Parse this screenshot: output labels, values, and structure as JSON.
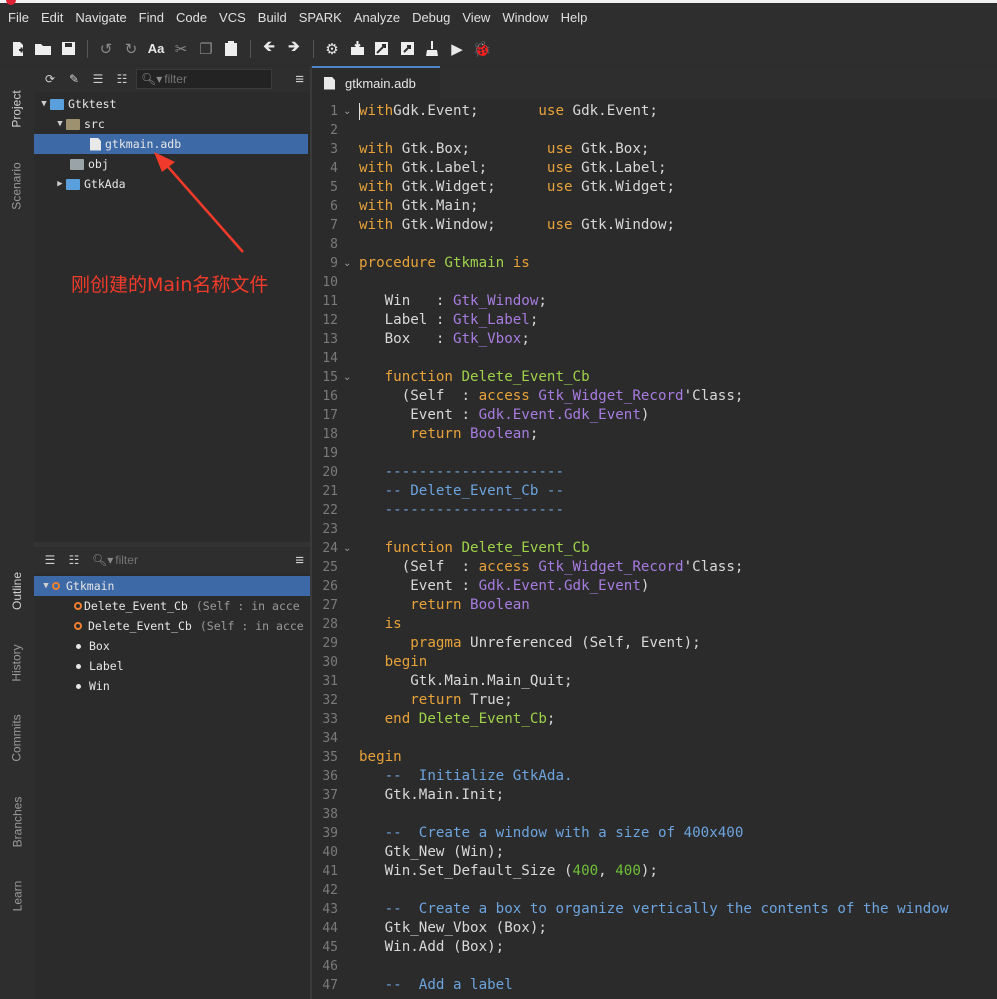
{
  "menubar": {
    "items": [
      "File",
      "Edit",
      "Navigate",
      "Find",
      "Code",
      "VCS",
      "Build",
      "SPARK",
      "Analyze",
      "Debug",
      "View",
      "Window",
      "Help"
    ]
  },
  "toolbar": {
    "buttons": [
      "new-file-icon",
      "open-folder-icon",
      "save-icon",
      "undo-icon",
      "redo-icon",
      "font-case-icon",
      "cut-icon",
      "copy-icon",
      "paste-icon",
      "back-icon",
      "forward-icon",
      "gear-check-icon",
      "build-icon",
      "build-all-icon",
      "build-target-icon",
      "clean-icon",
      "run-icon",
      "debug-icon"
    ]
  },
  "side_tabs": {
    "project": "Project",
    "scenario": "Scenario",
    "outline": "Outline",
    "history": "History",
    "commits": "Commits",
    "branches": "Branches",
    "learn": "Learn"
  },
  "project": {
    "filter_placeholder": "filter",
    "tree": {
      "root": "Gtktest",
      "src": "src",
      "file": "gtkmain.adb",
      "obj": "obj",
      "gtkada": "GtkAda"
    }
  },
  "annotation": {
    "text": "刚创建的Main名称文件"
  },
  "outline": {
    "filter_placeholder": "filter",
    "items": {
      "root": "Gtkmain",
      "cb1": "Delete_Event_Cb",
      "cb1_sig": "(Self : in acce",
      "cb2": "Delete_Event_Cb",
      "cb2_sig": "(Self : in acce",
      "box": "Box",
      "label": "Label",
      "win": "Win"
    }
  },
  "editor": {
    "tab_title": "gtkmain.adb",
    "line_numbers": [
      "1",
      "2",
      "3",
      "4",
      "5",
      "6",
      "7",
      "8",
      "9",
      "10",
      "11",
      "12",
      "13",
      "14",
      "15",
      "16",
      "17",
      "18",
      "19",
      "20",
      "21",
      "22",
      "23",
      "24",
      "25",
      "26",
      "27",
      "28",
      "29",
      "30",
      "31",
      "32",
      "33",
      "34",
      "35",
      "36",
      "37",
      "38",
      "39",
      "40",
      "41",
      "42",
      "43",
      "44",
      "45",
      "46",
      "47"
    ],
    "fold_lines": [
      1,
      9,
      15,
      24
    ],
    "lines": [
      [
        [
          "kw",
          "with"
        ],
        [
          "",
          "Gdk.Event;       "
        ],
        [
          "kw",
          "use"
        ],
        [
          "",
          " Gdk.Event;"
        ]
      ],
      [],
      [
        [
          "kw",
          "with"
        ],
        [
          "",
          " Gtk.Box;         "
        ],
        [
          "kw",
          "use"
        ],
        [
          "",
          " Gtk.Box;"
        ]
      ],
      [
        [
          "kw",
          "with"
        ],
        [
          "",
          " Gtk.Label;       "
        ],
        [
          "kw",
          "use"
        ],
        [
          "",
          " Gtk.Label;"
        ]
      ],
      [
        [
          "kw",
          "with"
        ],
        [
          "",
          " Gtk.Widget;      "
        ],
        [
          "kw",
          "use"
        ],
        [
          "",
          " Gtk.Widget;"
        ]
      ],
      [
        [
          "kw",
          "with"
        ],
        [
          "",
          " Gtk.Main;"
        ]
      ],
      [
        [
          "kw",
          "with"
        ],
        [
          "",
          " Gtk.Window;      "
        ],
        [
          "kw",
          "use"
        ],
        [
          "",
          " Gtk.Window;"
        ]
      ],
      [],
      [
        [
          "kw",
          "procedure"
        ],
        [
          "",
          " "
        ],
        [
          "fn",
          "Gtkmain"
        ],
        [
          "",
          " "
        ],
        [
          "kw",
          "is"
        ]
      ],
      [],
      [
        [
          "",
          "   Win   : "
        ],
        [
          "ty",
          "Gtk_Window"
        ],
        [
          "",
          ";"
        ]
      ],
      [
        [
          "",
          "   Label : "
        ],
        [
          "ty",
          "Gtk_Label"
        ],
        [
          "",
          ";"
        ]
      ],
      [
        [
          "",
          "   Box   : "
        ],
        [
          "ty",
          "Gtk_Vbox"
        ],
        [
          "",
          ";"
        ]
      ],
      [],
      [
        [
          "",
          "   "
        ],
        [
          "kw",
          "function"
        ],
        [
          "",
          " "
        ],
        [
          "fn",
          "Delete_Event_Cb"
        ]
      ],
      [
        [
          "",
          "     (Self  : "
        ],
        [
          "kw",
          "access"
        ],
        [
          "",
          " "
        ],
        [
          "ty",
          "Gtk_Widget_Record"
        ],
        [
          "",
          "'Class;"
        ]
      ],
      [
        [
          "",
          "      Event : "
        ],
        [
          "ty",
          "Gdk.Event.Gdk_Event"
        ],
        [
          "",
          ")"
        ]
      ],
      [
        [
          "",
          "      "
        ],
        [
          "kw",
          "return"
        ],
        [
          "",
          " "
        ],
        [
          "ty",
          "Boolean"
        ],
        [
          "",
          ";"
        ]
      ],
      [],
      [
        [
          "",
          "   "
        ],
        [
          "cm",
          "---------------------"
        ]
      ],
      [
        [
          "",
          "   "
        ],
        [
          "cm",
          "-- Delete_Event_Cb --"
        ]
      ],
      [
        [
          "",
          "   "
        ],
        [
          "cm",
          "---------------------"
        ]
      ],
      [],
      [
        [
          "",
          "   "
        ],
        [
          "kw",
          "function"
        ],
        [
          "",
          " "
        ],
        [
          "fn",
          "Delete_Event_Cb"
        ]
      ],
      [
        [
          "",
          "     (Self  : "
        ],
        [
          "kw",
          "access"
        ],
        [
          "",
          " "
        ],
        [
          "ty",
          "Gtk_Widget_Record"
        ],
        [
          "",
          "'Class;"
        ]
      ],
      [
        [
          "",
          "      Event : "
        ],
        [
          "ty",
          "Gdk.Event.Gdk_Event"
        ],
        [
          "",
          ")"
        ]
      ],
      [
        [
          "",
          "      "
        ],
        [
          "kw",
          "return"
        ],
        [
          "",
          " "
        ],
        [
          "ty",
          "Boolean"
        ]
      ],
      [
        [
          "",
          "   "
        ],
        [
          "kw",
          "is"
        ]
      ],
      [
        [
          "",
          "      "
        ],
        [
          "kw",
          "pragma"
        ],
        [
          "",
          " Unreferenced (Self, Event);"
        ]
      ],
      [
        [
          "",
          "   "
        ],
        [
          "kw",
          "begin"
        ]
      ],
      [
        [
          "",
          "      Gtk.Main.Main_Quit;"
        ]
      ],
      [
        [
          "",
          "      "
        ],
        [
          "kw",
          "return"
        ],
        [
          "",
          " True;"
        ]
      ],
      [
        [
          "",
          "   "
        ],
        [
          "kw",
          "end"
        ],
        [
          "",
          " "
        ],
        [
          "fn",
          "Delete_Event_Cb"
        ],
        [
          "",
          ";"
        ]
      ],
      [],
      [
        [
          "kw",
          "begin"
        ]
      ],
      [
        [
          "",
          "   "
        ],
        [
          "cm",
          "--  Initialize GtkAda."
        ]
      ],
      [
        [
          "",
          "   Gtk.Main.Init;"
        ]
      ],
      [],
      [
        [
          "",
          "   "
        ],
        [
          "cm",
          "--  Create a window with a size of 400x400"
        ]
      ],
      [
        [
          "",
          "   Gtk_New (Win);"
        ]
      ],
      [
        [
          "",
          "   Win.Set_Default_Size ("
        ],
        [
          "nm",
          "400"
        ],
        [
          "",
          ", "
        ],
        [
          "nm",
          "400"
        ],
        [
          "",
          ");"
        ]
      ],
      [],
      [
        [
          "",
          "   "
        ],
        [
          "cm",
          "--  Create a box to organize vertically the contents of the window"
        ]
      ],
      [
        [
          "",
          "   Gtk_New_Vbox (Box);"
        ]
      ],
      [
        [
          "",
          "   Win.Add (Box);"
        ]
      ],
      [],
      [
        [
          "",
          "   "
        ],
        [
          "cm",
          "--  Add a label"
        ]
      ]
    ]
  }
}
